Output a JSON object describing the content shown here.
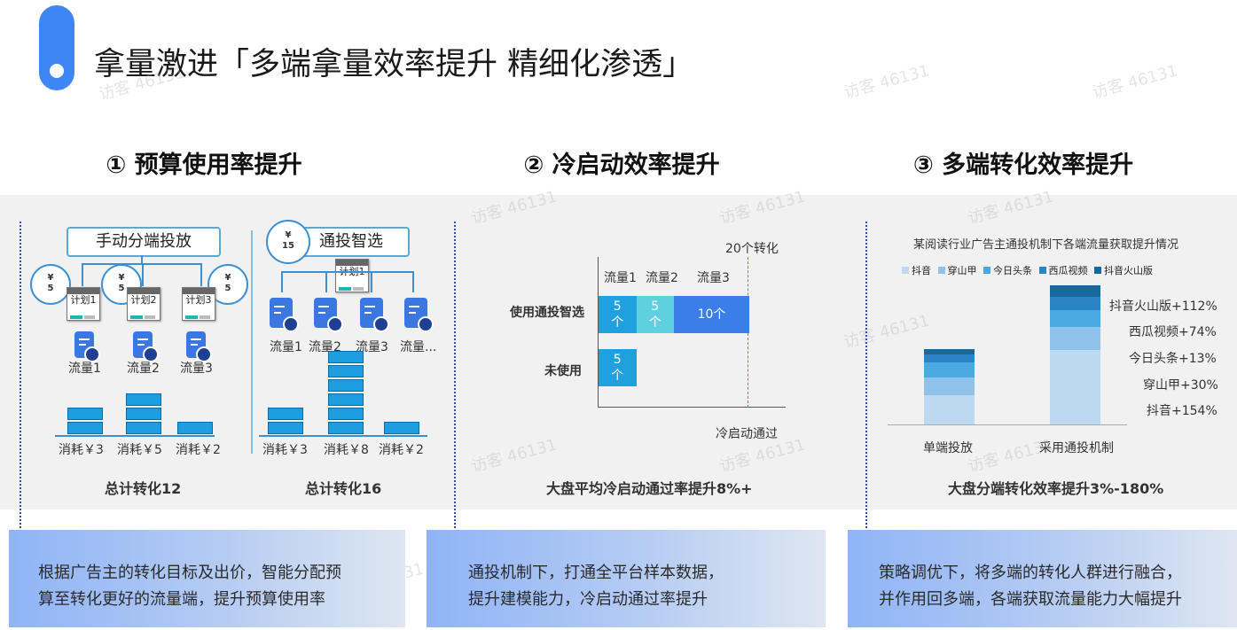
{
  "title": "拿量激进「多端拿量效率提升 精细化渗透」",
  "watermark": "访客 46131",
  "sections": [
    {
      "title": "① 预算使用率提升",
      "description_lines": [
        "根据广告主的转化目标及出价，智能分配预",
        "算至转化更好的流量端，提升预算使用率"
      ]
    },
    {
      "title": "② 冷启动效率提升",
      "description_lines": [
        "通投机制下，打通全平台样本数据，",
        "提升建模能力，冷启动通过率提升"
      ]
    },
    {
      "title": "③ 多端转化效率提升",
      "description_lines": [
        "策略调优下，将多端的转化人群进行融合，",
        "并作用回多端，各端获取流量能力大幅提升"
      ]
    }
  ],
  "budget": {
    "manual": {
      "header": "手动分端投放",
      "coins": [
        {
          "symbol": "¥",
          "value": "5"
        },
        {
          "symbol": "¥",
          "value": "5"
        },
        {
          "symbol": "¥",
          "value": "5"
        }
      ],
      "plans": [
        "计划1",
        "计划2",
        "计划3"
      ],
      "flows": [
        "流量1",
        "流量2",
        "流量3"
      ],
      "consumption": [
        "消耗￥3",
        "消耗￥5",
        "消耗￥2"
      ],
      "block_counts": [
        2,
        3,
        1
      ],
      "total": "总计转化12"
    },
    "auto": {
      "header": "通投智选",
      "coin": {
        "symbol": "¥",
        "value": "15"
      },
      "plan": "计划1",
      "flows": [
        "流量1",
        "流量2",
        "流量3",
        "流量..."
      ],
      "consumption": [
        "消耗￥3",
        "消耗￥8",
        "消耗￥2"
      ],
      "block_counts": [
        2,
        6,
        1
      ],
      "total": "总计转化16"
    }
  },
  "chart_data": [
    {
      "type": "bar",
      "orientation": "horizontal",
      "stacked": true,
      "categories": [
        "使用通投智选",
        "未使用"
      ],
      "series": [
        {
          "name": "流量1",
          "values": [
            5,
            5
          ],
          "color": "#1fa1df"
        },
        {
          "name": "流量2",
          "values": [
            5,
            0
          ],
          "color": "#5fd0de"
        },
        {
          "name": "流量3",
          "values": [
            10,
            0
          ],
          "color": "#3b7de9"
        }
      ],
      "data_labels": [
        [
          "5\n个",
          "5\n个",
          "10个"
        ],
        [
          "5\n个"
        ]
      ],
      "reference_label": "20个转化",
      "xlabel": "冷启动通过",
      "summary": "大盘平均冷启动通过率提升8%+"
    },
    {
      "type": "bar",
      "stacked": true,
      "title": "某阅读行业广告主通投机制下各端流量获取提升情况",
      "categories": [
        "单端投放",
        "采用通投机制"
      ],
      "legend": [
        "抖音",
        "穿山甲",
        "今日头条",
        "西瓜视频",
        "抖音火山版"
      ],
      "series": [
        {
          "name": "抖音",
          "values": [
            33,
            84
          ],
          "color": "#bcd9f1"
        },
        {
          "name": "穿山甲",
          "values": [
            20,
            26
          ],
          "color": "#8ec2ea"
        },
        {
          "name": "今日头条",
          "values": [
            17,
            19
          ],
          "color": "#4aa9e0"
        },
        {
          "name": "西瓜视频",
          "values": [
            9,
            15
          ],
          "color": "#2a84c6"
        },
        {
          "name": "抖音火山版",
          "values": [
            6,
            13
          ],
          "color": "#176a9d"
        }
      ],
      "annotations": [
        "抖音火山版+112%",
        "西瓜视频+74%",
        "今日头条+13%",
        "穿山甲+30%",
        "抖音+154%"
      ],
      "summary": "大盘分端转化效率提升3%-180%"
    }
  ]
}
